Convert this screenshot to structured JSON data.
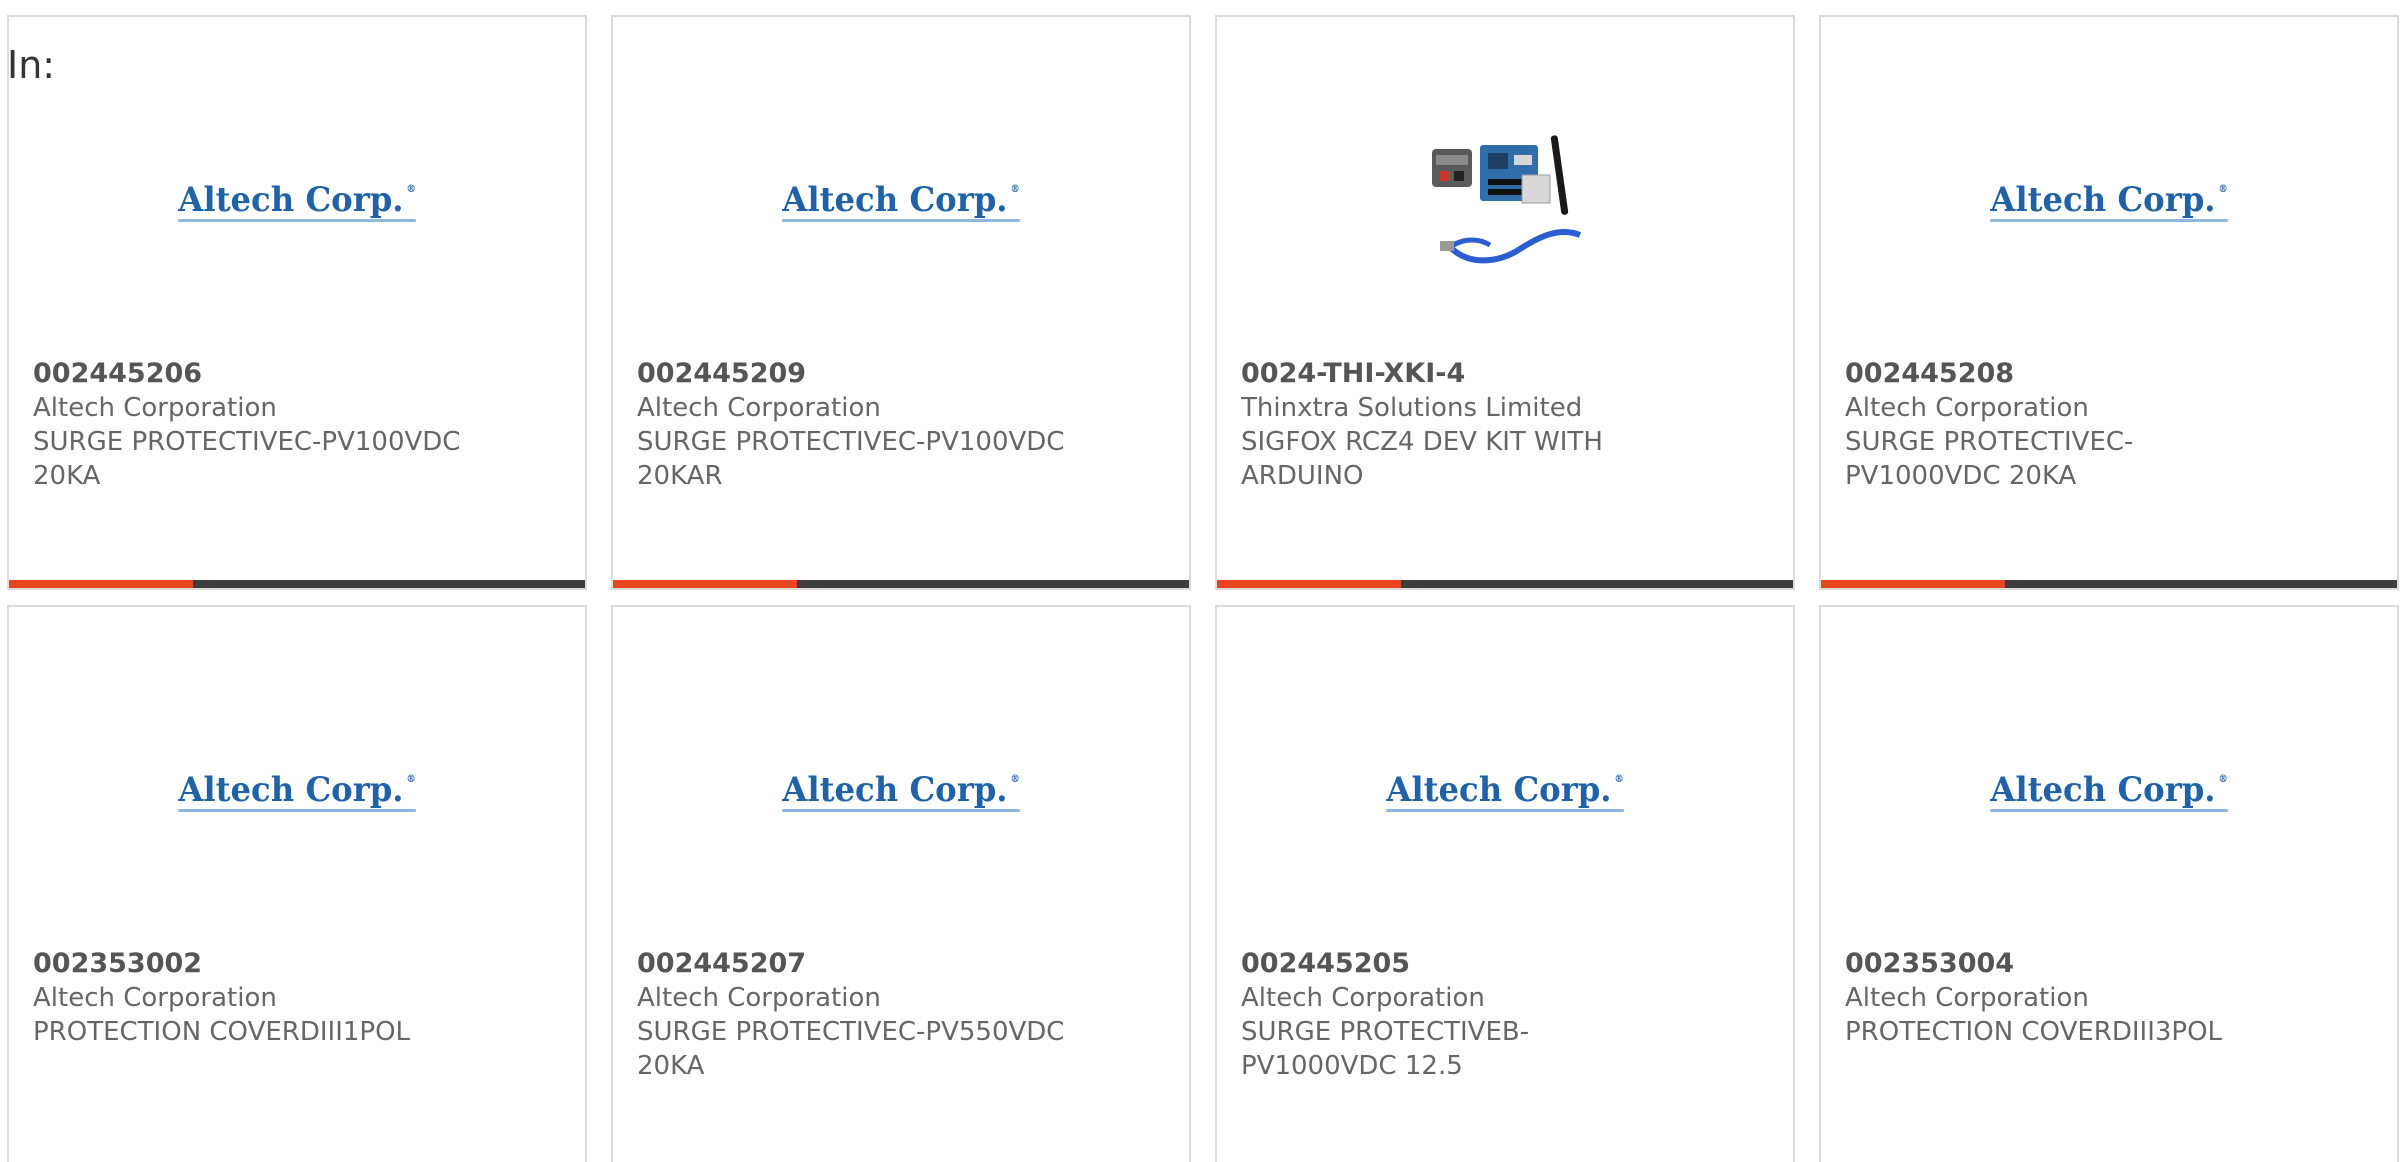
{
  "header": {
    "in_label": "In:"
  },
  "colors": {
    "accent": "#e8441f",
    "bar_dark": "#3d3d3d",
    "logo_blue": "#1f62a8"
  },
  "products": [
    {
      "sku": "002445206",
      "manufacturer": "Altech Corporation",
      "desc1": "SURGE PROTECTIVEC-PV100VDC",
      "desc2": "20KA",
      "image": "altech-logo",
      "logo_text": "Altech Corp.",
      "logo_mark": "®",
      "progress": 0.32
    },
    {
      "sku": "002445209",
      "manufacturer": "Altech Corporation",
      "desc1": "SURGE PROTECTIVEC-PV100VDC",
      "desc2": "20KAR",
      "image": "altech-logo",
      "logo_text": "Altech Corp.",
      "logo_mark": "®",
      "progress": 0.32
    },
    {
      "sku": "0024-THI-XKI-4",
      "manufacturer": "Thinxtra Solutions Limited",
      "desc1": "SIGFOX RCZ4 DEV KIT WITH",
      "desc2": "ARDUINO",
      "image": "dev-kit-photo",
      "progress": 0.32
    },
    {
      "sku": "002445208",
      "manufacturer": "Altech Corporation",
      "desc1": "SURGE PROTECTIVEC-",
      "desc2": "PV1000VDC 20KA",
      "image": "altech-logo",
      "logo_text": "Altech Corp.",
      "logo_mark": "®",
      "progress": 0.32
    },
    {
      "sku": "002353002",
      "manufacturer": "Altech Corporation",
      "desc1": "PROTECTION COVERDIII1POL",
      "desc2": "",
      "image": "altech-logo",
      "logo_text": "Altech Corp.",
      "logo_mark": "®"
    },
    {
      "sku": "002445207",
      "manufacturer": "Altech Corporation",
      "desc1": "SURGE PROTECTIVEC-PV550VDC",
      "desc2": "20KA",
      "image": "altech-logo",
      "logo_text": "Altech Corp.",
      "logo_mark": "®"
    },
    {
      "sku": "002445205",
      "manufacturer": "Altech Corporation",
      "desc1": "SURGE PROTECTIVEB-",
      "desc2": "PV1000VDC 12.5",
      "image": "altech-logo",
      "logo_text": "Altech Corp.",
      "logo_mark": "®"
    },
    {
      "sku": "002353004",
      "manufacturer": "Altech Corporation",
      "desc1": "PROTECTION COVERDIII3POL",
      "desc2": "",
      "image": "altech-logo",
      "logo_text": "Altech Corp.",
      "logo_mark": "®"
    }
  ]
}
